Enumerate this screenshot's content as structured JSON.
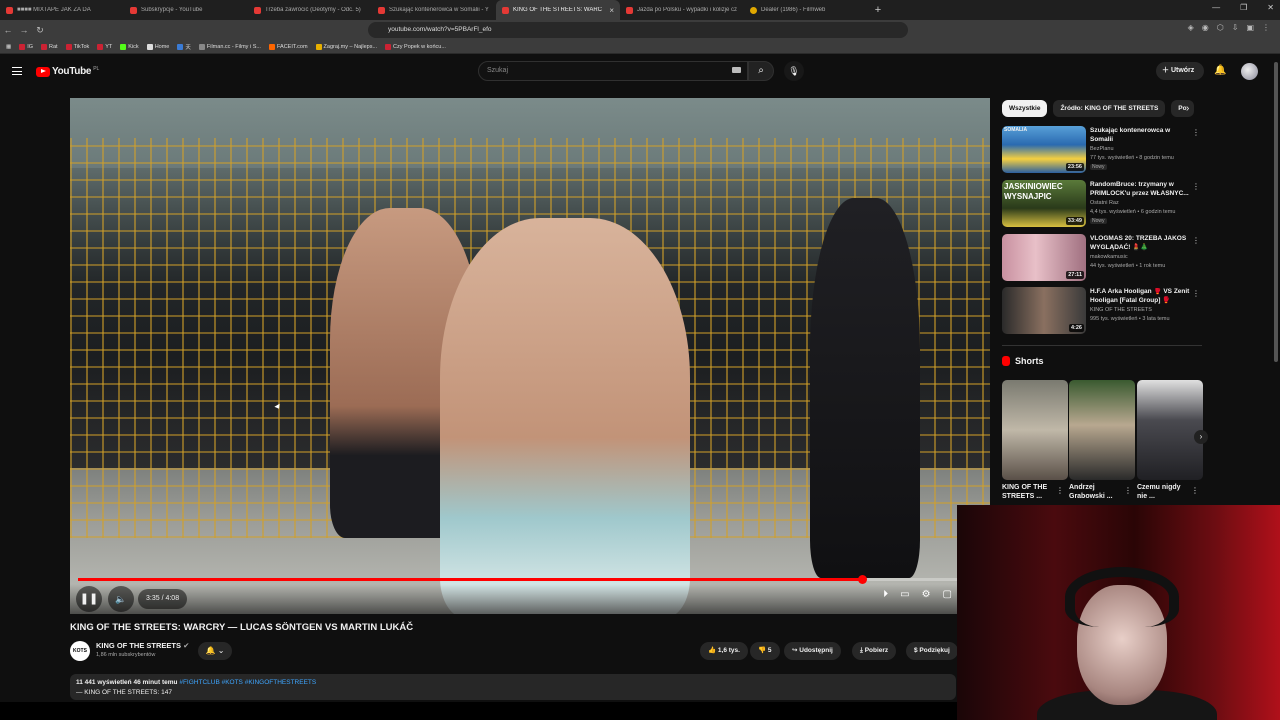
{
  "browser": {
    "tabs": [
      {
        "label": "■■■■ MIXTAPE JAK ZA DA",
        "active": false
      },
      {
        "label": "Subskrypcje - YouTube",
        "active": false
      },
      {
        "label": "Trzeba zawrócić (Deotymy - Odc. 5)",
        "active": false
      },
      {
        "label": "Szukając kontenerowca w Somalii - Y",
        "active": false
      },
      {
        "label": "KING OF THE STREETS: WARC",
        "active": true
      },
      {
        "label": "Jazda po Polsku - wypadki i kolizje cz",
        "active": false
      },
      {
        "label": "Dealer (1986) - Filmweb",
        "active": false
      }
    ],
    "url": "youtube.com/watch?v=5PBArFl_efo",
    "bookmarks": [
      "IG",
      "Rat",
      "TikTok",
      "YT",
      "Kick",
      "Home",
      "天",
      "Filman.cc - Filmy i S...",
      "FACEIT.com",
      "Zagraj.my – Najleps...",
      "Czy Popek w końcu..."
    ]
  },
  "header": {
    "logo_text": "YouTube",
    "country_code": "PL",
    "search_placeholder": "Szukaj",
    "create_label": "Utwórz"
  },
  "player": {
    "time": "3:35 / 4:08",
    "progress_fraction": 0.867
  },
  "video": {
    "title": "KING OF THE STREETS: WARCRY — LUCAS SÖNTGEN VS MARTIN LUKÁČ",
    "channel": "KING OF THE STREETS",
    "avatar_text": "KOTS",
    "subscribers": "1,86 mln subskrybentów",
    "likes": "1,6 tys.",
    "dislikes": "5",
    "share_label": "Udostępnij",
    "download_label": "Pobierz",
    "thanks_label": "Podziękuj",
    "views_line": "11 441 wyświetleń  46 minut temu",
    "hashtags": "#FIGHTCLUB #KOTS #KINGOFTHESTREETS",
    "desc_line2": "— KING OF THE STREETS: 147"
  },
  "chips": [
    "Wszystkie",
    "Źródło: KING OF THE STREETS",
    "Po"
  ],
  "recommendations": [
    {
      "title": "Szukając kontenerowca w Somalii",
      "channel": "BezPlanu",
      "meta": "77 tys. wyświetleń • 8 godzin temu",
      "badge": "Nowy",
      "duration": "23:56",
      "thumb_text": "SOMALIA"
    },
    {
      "title": "RandomBruce: trzymany w PRIMLOCK'u przez WŁASNYC...",
      "channel": "Ostatni Raz",
      "meta": "4,4 tys. wyświetleń • 6 godzin temu",
      "badge": "Nowy",
      "duration": "33:49",
      "thumb_text": "JASKINIOWIEC WYSNAJPIC"
    },
    {
      "title": "VLOGMAS 20: TRZEBA JAKOŚ WYGLĄDAĆ! 💄🎄",
      "channel": "makowkamusic",
      "meta": "44 tys. wyświetleń • 1 rok temu",
      "badge": "",
      "duration": "27:11",
      "thumb_text": ""
    },
    {
      "title": "H.F.A Arka Hooligan 🥊 VS Zenit Hooligan [Fatal Group] 🥊 [Kast...",
      "channel": "KING OF THE STREETS",
      "meta": "995 tys. wyświetleń • 3 lata temu",
      "badge": "",
      "duration": "4:26",
      "thumb_text": ""
    }
  ],
  "shorts": {
    "heading": "Shorts",
    "items": [
      {
        "title": "KING OF THE STREETS ..."
      },
      {
        "title": "Andrzej Grabowski ..."
      },
      {
        "title": "Czemu nigdy nie ..."
      }
    ]
  },
  "colors": {
    "accent": "#ff0000",
    "link": "#3ea6ff",
    "bg": "#0f0f0f"
  }
}
